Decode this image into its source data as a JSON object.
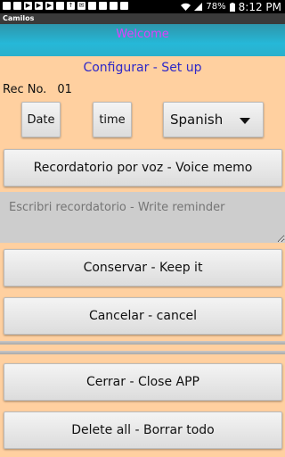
{
  "status_bar": {
    "notification_icons": [
      "camilos-icon",
      "square-icon",
      "youtube-icon",
      "youtube-icon",
      "play-icon",
      "image-icon",
      "upload-icon",
      "mail-icon",
      "square-icon",
      "square-icon",
      "square-icon",
      "square-icon"
    ],
    "battery": "78%",
    "time": "8:12 PM"
  },
  "app_bar": {
    "title": "Camilos"
  },
  "header": {
    "welcome": "Welcome"
  },
  "config": {
    "label": "Configurar  - Set up"
  },
  "record": {
    "label": "Rec No.",
    "number": "01"
  },
  "controls": {
    "date_label": "Date",
    "time_label": "time",
    "language_selected": "Spanish"
  },
  "buttons": {
    "voice_memo": "Recordatorio por voz  - Voice memo",
    "keep": "Conservar - Keep it",
    "cancel": "Cancelar - cancel",
    "close": "Cerrar - Close  APP",
    "delete_all": "Delete all - Borrar todo"
  },
  "reminder": {
    "placeholder": "Escribri recordatorio - Write reminder"
  },
  "colors": {
    "background": "#ffd0a0",
    "header": "#26b8d8",
    "welcome_text": "#e040fb",
    "config_text": "#2e28c8"
  }
}
